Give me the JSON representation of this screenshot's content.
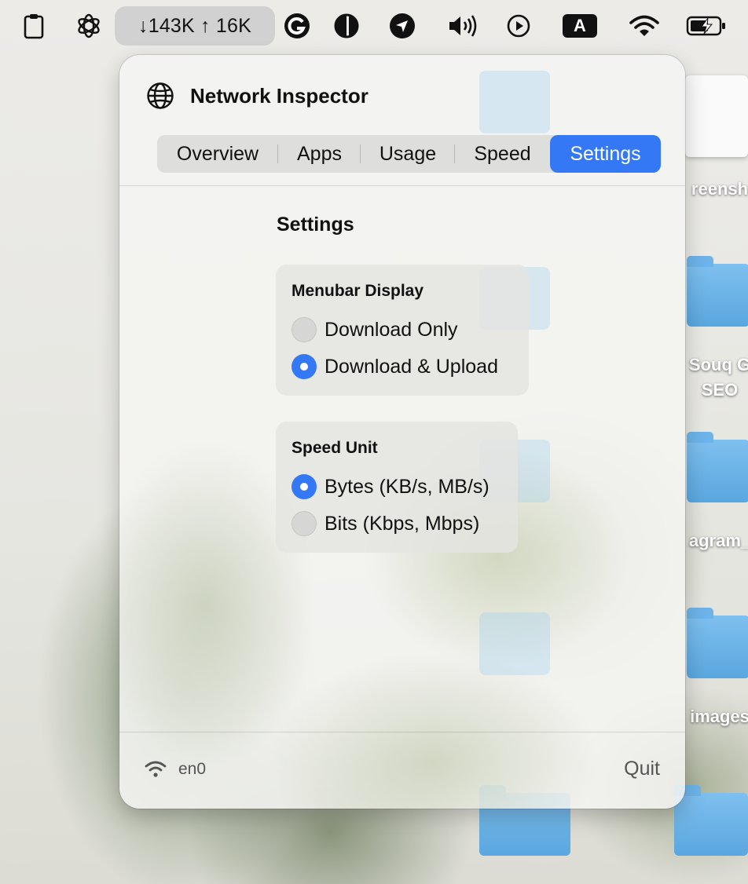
{
  "menubar": {
    "net_speed": "↓143K ↑ 16K",
    "keyboard_letter": "A",
    "icons": [
      "clipboard-icon",
      "openai-icon",
      "grammarly-icon",
      "contrast-icon",
      "location-arrow-icon",
      "volume-icon",
      "play-circle-icon",
      "input-source-icon",
      "wifi-icon",
      "battery-charging-icon"
    ]
  },
  "desktop": {
    "labels": [
      "reensh",
      "Souq G",
      "SEO",
      "agram_",
      "images"
    ]
  },
  "popover": {
    "title": "Network Inspector",
    "tabs": [
      {
        "label": "Overview"
      },
      {
        "label": "Apps"
      },
      {
        "label": "Usage"
      },
      {
        "label": "Speed"
      },
      {
        "label": "Settings",
        "selected": true
      }
    ],
    "section_title": "Settings",
    "groups": [
      {
        "title": "Menubar Display",
        "options": [
          {
            "label": "Download Only",
            "selected": false
          },
          {
            "label": "Download & Upload",
            "selected": true
          }
        ]
      },
      {
        "title": "Speed Unit",
        "options": [
          {
            "label": "Bytes (KB/s, MB/s)",
            "selected": true
          },
          {
            "label": "Bits (Kbps, Mbps)",
            "selected": false
          }
        ]
      }
    ],
    "footer": {
      "interface": "en0",
      "quit_label": "Quit"
    }
  },
  "colors": {
    "accent": "#3478f6"
  }
}
